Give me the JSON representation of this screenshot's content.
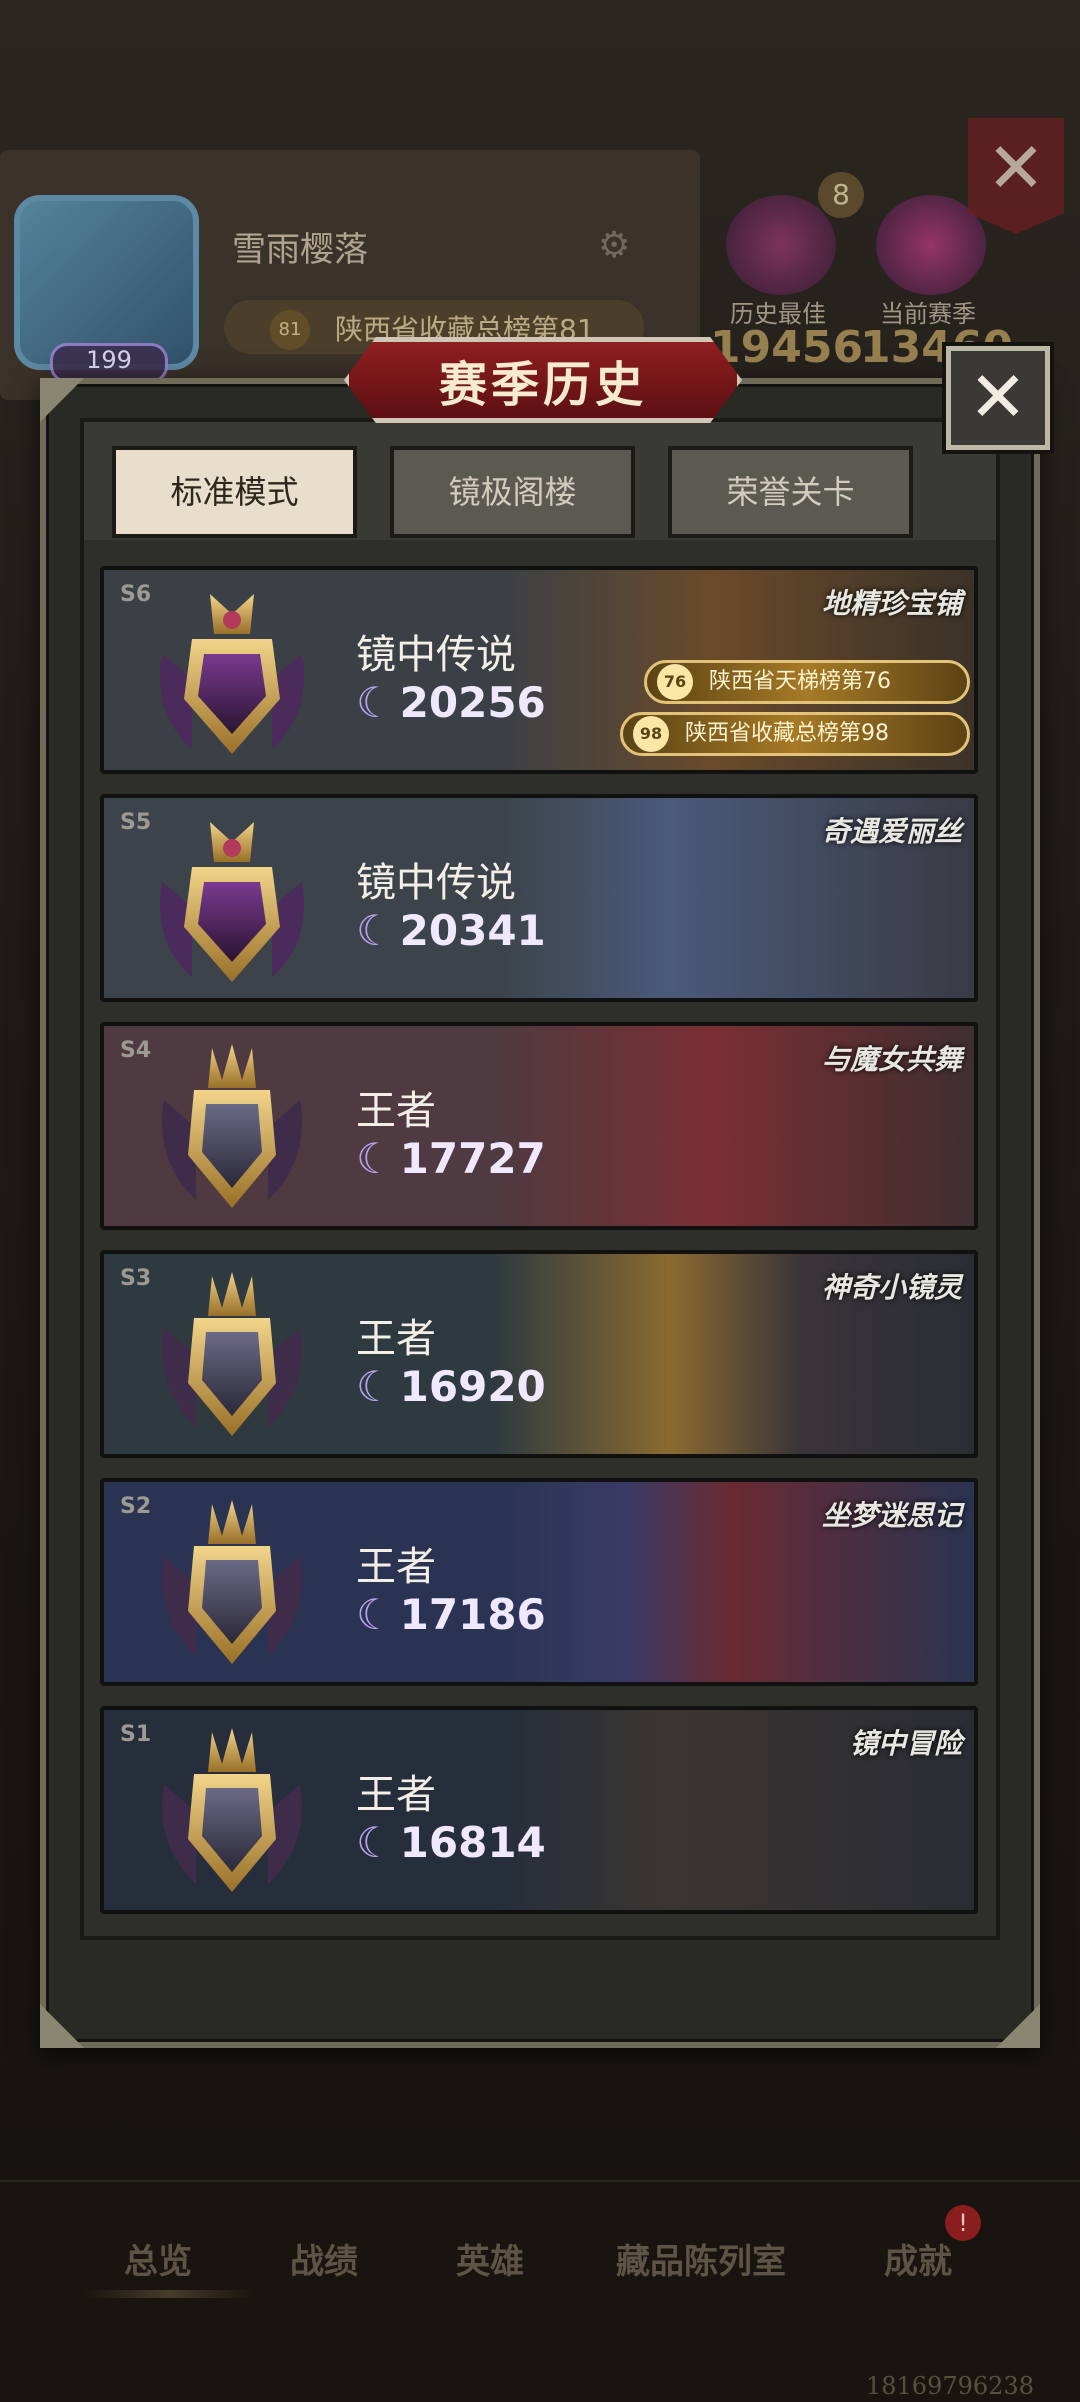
{
  "profile": {
    "name": "雪雨樱落",
    "level": "199",
    "rank_ribbon": "陕西省收藏总榜第81",
    "rank_ribbon_badge": "81",
    "badge_8": "8",
    "history_best_label": "历史最佳",
    "current_season_label": "当前赛季",
    "history_best_score": "19456",
    "current_season_score": "13460"
  },
  "dialog": {
    "title": "赛季历史",
    "close_glyph": "✕",
    "tabs": [
      {
        "label": "标准模式",
        "active": true
      },
      {
        "label": "镜极阁楼",
        "active": false
      },
      {
        "label": "荣誉关卡",
        "active": false
      }
    ]
  },
  "seasons": [
    {
      "tag": "S6",
      "series": "地精珍宝铺",
      "tier": "镜中传说",
      "moon": "☾",
      "score": "20256",
      "ranks": [
        {
          "badge": "76",
          "text": "陕西省天梯榜第76"
        },
        {
          "badge": "98",
          "text": "陕西省收藏总榜第98"
        }
      ],
      "colors": {
        "bg": "#3a4045",
        "accent": "#9b6a2d"
      }
    },
    {
      "tag": "S5",
      "series": "奇遇爱丽丝",
      "tier": "镜中传说",
      "moon": "☾",
      "score": "20341",
      "ranks": [],
      "colors": {
        "bg": "#3d434a",
        "accent": "#5a6a8a"
      }
    },
    {
      "tag": "S4",
      "series": "与魔女共舞",
      "tier": "王者",
      "moon": "☾",
      "score": "17727",
      "ranks": [],
      "colors": {
        "bg": "#4e3a40",
        "accent": "#8a2f33"
      }
    },
    {
      "tag": "S3",
      "series": "神奇小镜灵",
      "tier": "王者",
      "moon": "☾",
      "score": "16920",
      "ranks": [],
      "colors": {
        "bg": "#2f3a40",
        "accent": "#c78634"
      }
    },
    {
      "tag": "S2",
      "series": "坐梦迷思记",
      "tier": "王者",
      "moon": "☾",
      "score": "17186",
      "ranks": [],
      "colors": {
        "bg": "#2a3352",
        "accent": "#7a2a33"
      }
    },
    {
      "tag": "S1",
      "series": "镜中冒险",
      "tier": "王者",
      "moon": "☾",
      "score": "16814",
      "ranks": [],
      "colors": {
        "bg": "#262e3c",
        "accent": "#4a3a2a"
      }
    }
  ],
  "bottom_nav": [
    "总览",
    "战绩",
    "英雄",
    "藏品陈列室",
    "成就"
  ],
  "notification_glyph": "!",
  "uid": "18169796238"
}
